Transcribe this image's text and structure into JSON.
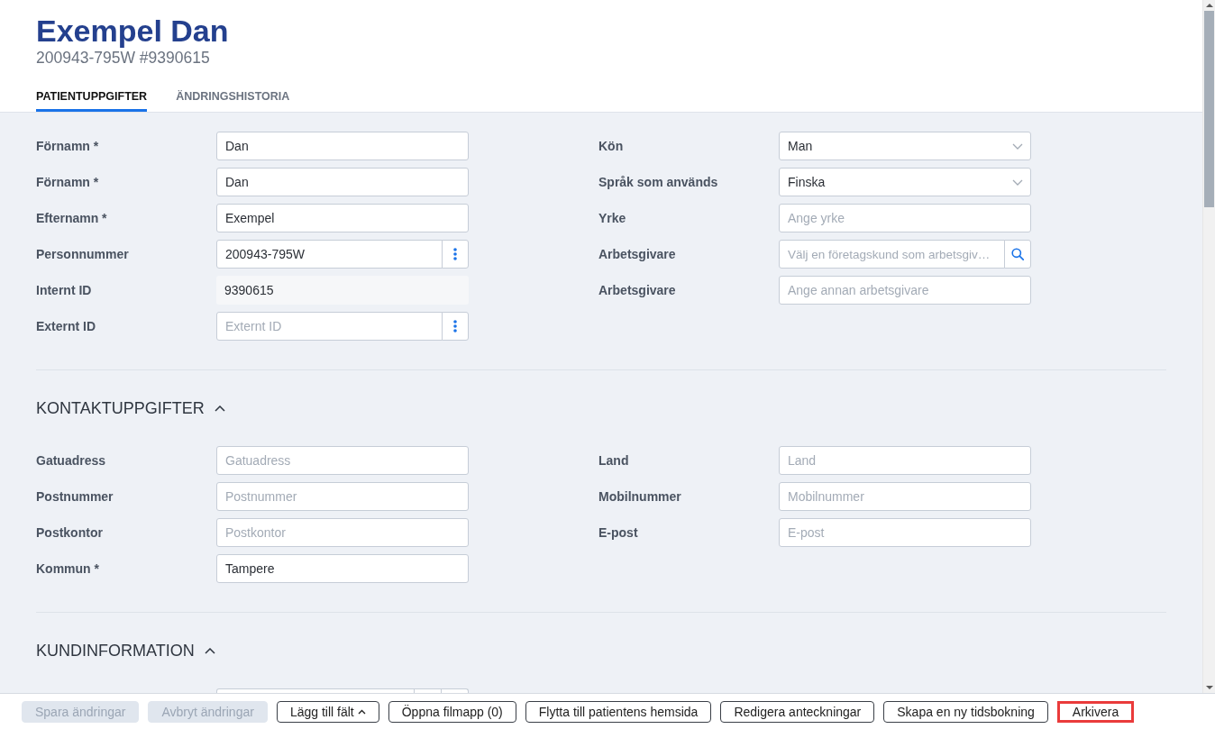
{
  "header": {
    "title": "Exempel Dan",
    "subtitle": "200943-795W #9390615"
  },
  "tabs": [
    {
      "label": "PATIENTUPPGIFTER",
      "selected": true
    },
    {
      "label": "ÄNDRINGSHISTORIA",
      "selected": false
    }
  ],
  "patient_details": {
    "left": [
      {
        "kind": "text",
        "label": "Förnamn *",
        "value": "Dan"
      },
      {
        "kind": "text",
        "label": "Förnamn *",
        "value": "Dan"
      },
      {
        "kind": "text",
        "label": "Efternamn *",
        "value": "Exempel"
      },
      {
        "kind": "menu",
        "label": "Personnummer",
        "value": "200943-795W"
      },
      {
        "kind": "readonly",
        "label": "Internt ID",
        "value": "9390615"
      },
      {
        "kind": "menu",
        "label": "Externt ID",
        "placeholder": "Externt ID"
      }
    ],
    "right": [
      {
        "kind": "select",
        "label": "Kön",
        "value": "Man"
      },
      {
        "kind": "select",
        "label": "Språk som används",
        "value": "Finska"
      },
      {
        "kind": "text",
        "label": "Yrke",
        "placeholder": "Ange yrke"
      },
      {
        "kind": "search",
        "label": "Arbetsgivare",
        "placeholder": "Välj en företagskund som arbetsgiv…"
      },
      {
        "kind": "text",
        "label": "Arbetsgivare",
        "placeholder": "Ange annan arbetsgivare"
      }
    ]
  },
  "sections": [
    {
      "title": "KONTAKTUPPGIFTER",
      "expanded": true,
      "left": [
        {
          "kind": "text",
          "label": "Gatuadress",
          "placeholder": "Gatuadress"
        },
        {
          "kind": "text",
          "label": "Postnummer",
          "placeholder": "Postnummer"
        },
        {
          "kind": "text",
          "label": "Postkontor",
          "placeholder": "Postkontor"
        },
        {
          "kind": "text",
          "label": "Kommun *",
          "value": "Tampere"
        }
      ],
      "right": [
        {
          "kind": "text",
          "label": "Land",
          "placeholder": "Land"
        },
        {
          "kind": "text",
          "label": "Mobilnummer",
          "placeholder": "Mobilnummer"
        },
        {
          "kind": "text",
          "label": "E-post",
          "placeholder": "E-post"
        }
      ]
    },
    {
      "title": "KUNDINFORMATION",
      "expanded": true,
      "left": [
        {
          "kind": "lookup"
        }
      ]
    }
  ],
  "footer_buttons": [
    {
      "label": "Spara ändringar",
      "kind": "plain",
      "disabled": true,
      "highlighted": false
    },
    {
      "label": "Avbryt ändringar",
      "kind": "plain",
      "disabled": true,
      "highlighted": false
    },
    {
      "label": "Lägg till fält",
      "kind": "menu",
      "disabled": false,
      "highlighted": false
    },
    {
      "label": "Öppna filmapp (0)",
      "kind": "plain",
      "disabled": false,
      "highlighted": false
    },
    {
      "label": "Flytta till patientens hemsida",
      "kind": "plain",
      "disabled": false,
      "highlighted": false
    },
    {
      "label": "Redigera anteckningar",
      "kind": "plain",
      "disabled": false,
      "highlighted": false
    },
    {
      "label": "Skapa en ny tidsbokning",
      "kind": "plain",
      "disabled": false,
      "highlighted": false
    },
    {
      "label": "Arkivera",
      "kind": "plain",
      "disabled": false,
      "highlighted": true
    }
  ]
}
